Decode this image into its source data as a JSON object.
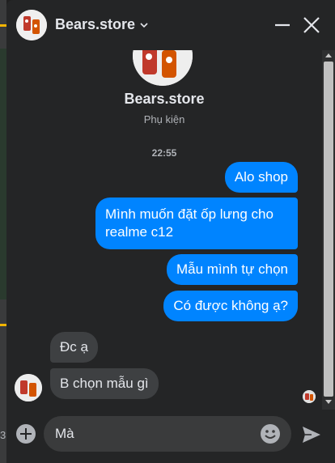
{
  "header": {
    "title": "Bears.store"
  },
  "profile": {
    "name": "Bears.store",
    "subtitle": "Phụ kiện"
  },
  "time": "22:55",
  "messages": [
    {
      "text": "Alo shop",
      "from": "me"
    },
    {
      "text": "Mình muốn đặt ốp lưng cho realme c12",
      "from": "me"
    },
    {
      "text": "Mẫu mình tự chọn",
      "from": "me"
    },
    {
      "text": "Có được không ạ?",
      "from": "me"
    },
    {
      "text": "Đc ạ",
      "from": "shop"
    },
    {
      "text": "B chọn mẫu gì",
      "from": "shop"
    }
  ],
  "composer": {
    "value": "Mà"
  },
  "background": {
    "edge_text": "3"
  },
  "colors": {
    "outgoing": "#0084ff",
    "incoming": "#3e4042",
    "panel": "#242526"
  },
  "icons": [
    "chevron-down-icon",
    "minimize-icon",
    "close-icon",
    "add-icon",
    "emoji-icon",
    "send-icon"
  ]
}
